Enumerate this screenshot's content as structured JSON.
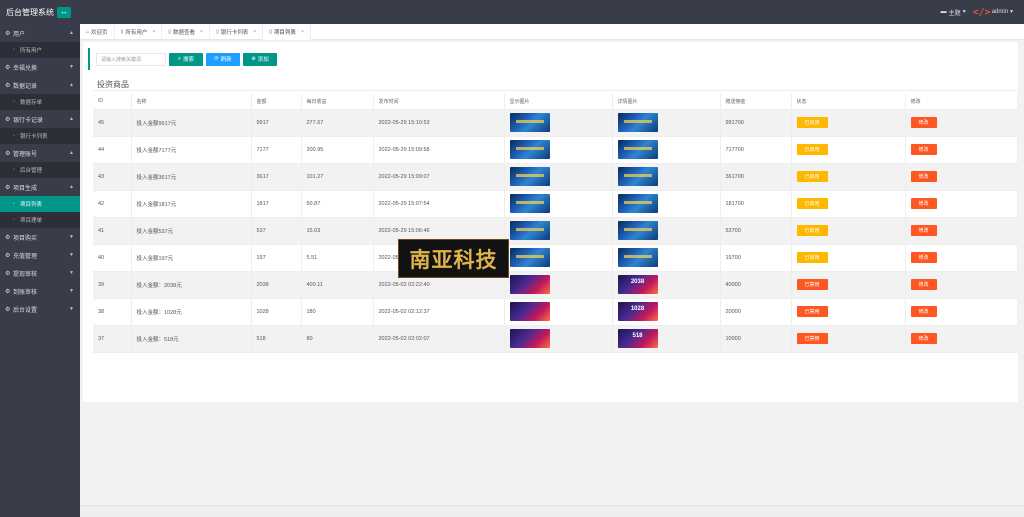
{
  "app": {
    "title": "后台管理系统",
    "toggle_icon": "menu-toggle-icon"
  },
  "topbar": {
    "lang": "主题",
    "admin": "admin"
  },
  "sidebar": [
    {
      "label": "用户",
      "sub": [
        "所有用户"
      ]
    },
    {
      "label": "幸福兑换",
      "sub": []
    },
    {
      "label": "数据记录",
      "sub": [
        "数据存单"
      ]
    },
    {
      "label": "银行卡记录",
      "sub": [
        "银行卡列表"
      ]
    },
    {
      "label": "管理账号",
      "sub": [
        "后台管理"
      ]
    },
    {
      "label": "项目生成",
      "sub": [
        "项目列表",
        "项目理单"
      ]
    },
    {
      "label": "项目购买",
      "sub": []
    },
    {
      "label": "充值管理",
      "sub": []
    },
    {
      "label": "提现审核",
      "sub": []
    },
    {
      "label": "到账审核",
      "sub": []
    },
    {
      "label": "后台设置",
      "sub": []
    }
  ],
  "tabs": [
    "欢迎页",
    "所有用户",
    "数据查看",
    "银行卡列表",
    "项目列表"
  ],
  "search": {
    "placeholder": "请输入搜索关键词",
    "search_btn": "搜索",
    "refresh_btn": "刷新",
    "add_btn": "添加"
  },
  "page_title": "投资商品",
  "table": {
    "headers": [
      "ID",
      "名称",
      "金额",
      "每日收益",
      "发布时间",
      "显示图片",
      "详情图片",
      "赠送佣金",
      "状态",
      "修改"
    ],
    "rows": [
      {
        "id": "45",
        "name": "投入金额9917元",
        "amount": "9917",
        "daily": "277.67",
        "time": "2022-05-29 15:10:53",
        "img": "blue",
        "img2": "blue",
        "commission": "991700",
        "status": "已启用",
        "status_color": "#ffb800",
        "edit": "修改"
      },
      {
        "id": "44",
        "name": "投入金额7177元",
        "amount": "7177",
        "daily": "200.95",
        "time": "2022-05-29 15:09:58",
        "img": "blue",
        "img2": "blue",
        "commission": "717700",
        "status": "已启用",
        "status_color": "#ffb800",
        "edit": "修改"
      },
      {
        "id": "43",
        "name": "投入金额3617元",
        "amount": "3617",
        "daily": "101.27",
        "time": "2022-05-29 15:09:07",
        "img": "blue",
        "img2": "blue",
        "commission": "361700",
        "status": "已启用",
        "status_color": "#ffb800",
        "edit": "修改"
      },
      {
        "id": "42",
        "name": "投入金额1817元",
        "amount": "1817",
        "daily": "50.87",
        "time": "2022-05-29 15:07:54",
        "img": "blue",
        "img2": "blue",
        "commission": "181700",
        "status": "已启用",
        "status_color": "#ffb800",
        "edit": "修改"
      },
      {
        "id": "41",
        "name": "投入金额537元",
        "amount": "537",
        "daily": "15.03",
        "time": "2022-05-29 15:06:46",
        "img": "blue",
        "img2": "blue",
        "commission": "53700",
        "status": "已启用",
        "status_color": "#ffb800",
        "edit": "修改"
      },
      {
        "id": "40",
        "name": "投入金额197元",
        "amount": "197",
        "daily": "5.51",
        "time": "2022-05-29 15:05:",
        "img": "blue",
        "img2": "blue",
        "commission": "19700",
        "status": "已启用",
        "status_color": "#ffb800",
        "edit": "修改"
      },
      {
        "id": "39",
        "name": "投入金额：2038元",
        "amount": "2038",
        "daily": "400.11",
        "time": "2022-05-02 02:22:40",
        "img": "alt",
        "img2": "alt",
        "img2_text": "2038",
        "commission": "40000",
        "status": "已禁用",
        "status_color": "#ff5722",
        "edit": "修改"
      },
      {
        "id": "38",
        "name": "投入金额：1028元",
        "amount": "1028",
        "daily": "180",
        "time": "2022-05-02 02:12:37",
        "img": "alt",
        "img2": "alt",
        "img2_text": "1028",
        "commission": "20000",
        "status": "已禁用",
        "status_color": "#ff5722",
        "edit": "修改"
      },
      {
        "id": "37",
        "name": "投入金额：518元",
        "amount": "518",
        "daily": "80",
        "time": "2022-05-02 02:02:07",
        "img": "alt",
        "img2": "alt",
        "img2_text": "518",
        "commission": "10000",
        "status": "已禁用",
        "status_color": "#ff5722",
        "edit": "修改"
      }
    ]
  },
  "watermark": "南亚科技"
}
